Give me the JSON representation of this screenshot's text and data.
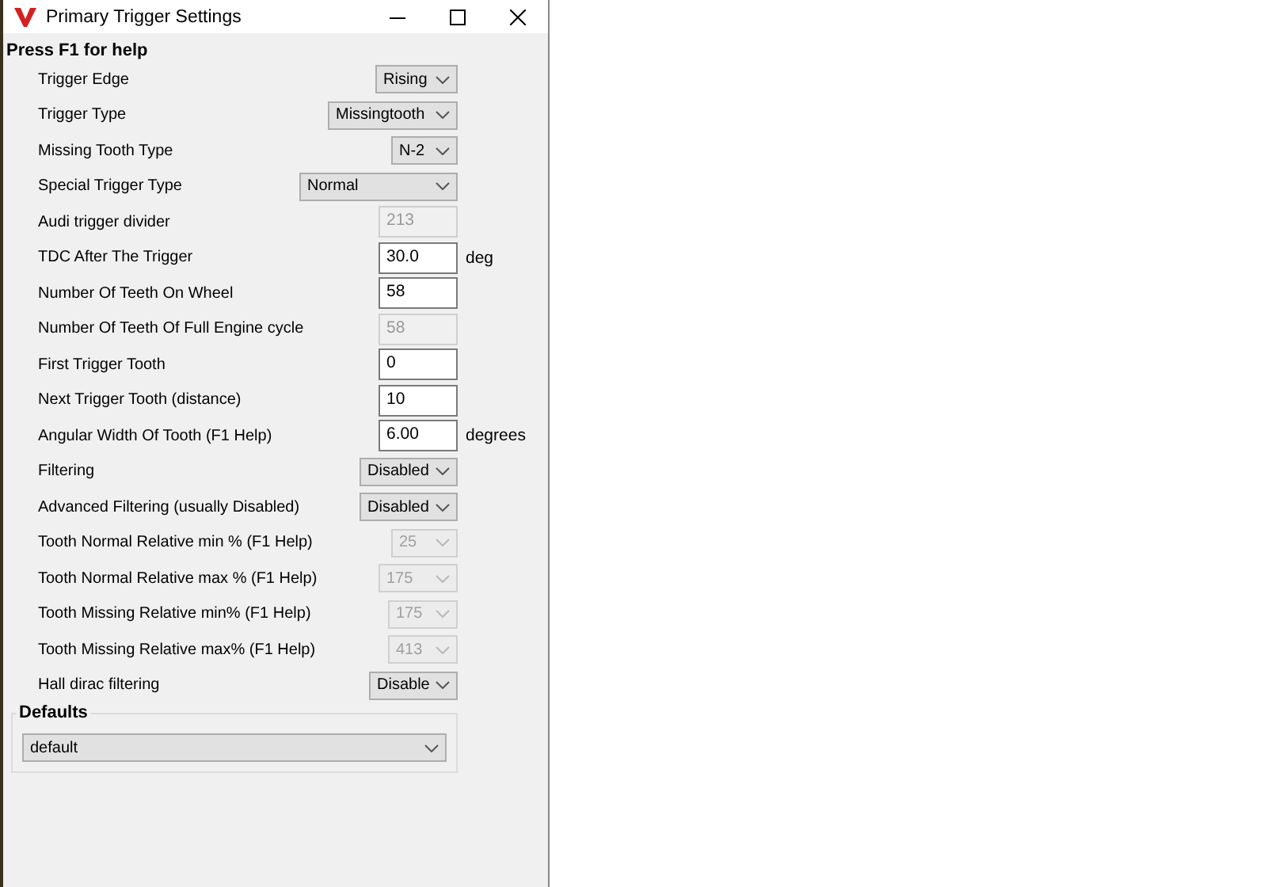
{
  "window": {
    "title": "Primary Trigger Settings"
  },
  "help_text": "Press F1 for help",
  "settings": [
    {
      "label": "Trigger Edge",
      "kind": "select",
      "value": "Rising",
      "disabled": false
    },
    {
      "label": "Trigger Type",
      "kind": "select",
      "value": "Missingtooth",
      "disabled": false
    },
    {
      "label": "Missing Tooth Type",
      "kind": "select",
      "value": "N-2",
      "disabled": false
    },
    {
      "label": "Special Trigger Type",
      "kind": "select",
      "value": "Normal",
      "disabled": false
    },
    {
      "label": "Audi trigger divider",
      "kind": "text",
      "value": "213",
      "disabled": true
    },
    {
      "label": "TDC After The Trigger",
      "kind": "text",
      "value": "30.0",
      "disabled": false,
      "unit": "deg"
    },
    {
      "label": "Number Of Teeth On Wheel",
      "kind": "text",
      "value": "58",
      "disabled": false
    },
    {
      "label": "Number Of Teeth Of Full Engine cycle",
      "kind": "text",
      "value": "58",
      "disabled": true
    },
    {
      "label": "First Trigger Tooth",
      "kind": "text",
      "value": "0",
      "disabled": false
    },
    {
      "label": "Next Trigger Tooth (distance)",
      "kind": "text",
      "value": "10",
      "disabled": false
    },
    {
      "label": "Angular Width Of Tooth (F1 Help)",
      "kind": "text",
      "value": "6.00",
      "disabled": false,
      "unit": "degrees"
    },
    {
      "label": "Filtering",
      "kind": "select",
      "value": "Disabled",
      "disabled": false
    },
    {
      "label": "Advanced Filtering (usually Disabled)",
      "kind": "select",
      "value": "Disabled",
      "disabled": false
    },
    {
      "label": "Tooth Normal Relative min % (F1 Help)",
      "kind": "select",
      "value": "25",
      "disabled": true
    },
    {
      "label": "Tooth Normal Relative max % (F1 Help)",
      "kind": "select",
      "value": "175",
      "disabled": true
    },
    {
      "label": "Tooth Missing Relative min% (F1 Help)",
      "kind": "select",
      "value": "175",
      "disabled": true
    },
    {
      "label": "Tooth Missing Relative max% (F1 Help)",
      "kind": "select",
      "value": "413",
      "disabled": true
    },
    {
      "label": "Hall dirac filtering",
      "kind": "select",
      "value": "Disable",
      "disabled": false
    }
  ],
  "defaults": {
    "title": "Defaults",
    "value": "default"
  }
}
